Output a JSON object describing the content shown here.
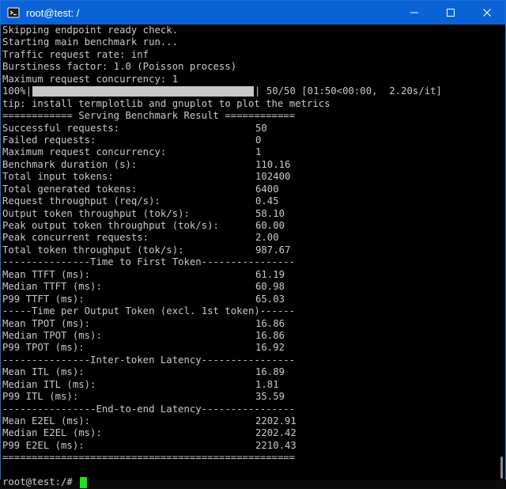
{
  "window": {
    "title": "root@test: /",
    "controls": [
      "minimize",
      "maximize",
      "close"
    ]
  },
  "terminal": {
    "intro_lines": [
      "Skipping endpoint ready check.",
      "Starting main benchmark run...",
      "Traffic request rate: inf",
      "Burstiness factor: 1.0 (Poisson process)",
      "Maximum request concurrency: 1"
    ],
    "progress": {
      "percent_label": "100%|",
      "fraction": 1.0,
      "status": "| 50/50 [01:50<00:00,  2.20s/it]"
    },
    "tip_line": "tip: install termplotlib and gnuplot to plot the metrics",
    "result_header": "============ Serving Benchmark Result ============",
    "summary": [
      {
        "label": "Successful requests:",
        "value": "50"
      },
      {
        "label": "Failed requests:",
        "value": "0"
      },
      {
        "label": "Maximum request concurrency:",
        "value": "1"
      },
      {
        "label": "Benchmark duration (s):",
        "value": "110.16"
      },
      {
        "label": "Total input tokens:",
        "value": "102400"
      },
      {
        "label": "Total generated tokens:",
        "value": "6400"
      },
      {
        "label": "Request throughput (req/s):",
        "value": "0.45"
      },
      {
        "label": "Output token throughput (tok/s):",
        "value": "58.10"
      },
      {
        "label": "Peak output token throughput (tok/s):",
        "value": "60.00"
      },
      {
        "label": "Peak concurrent requests:",
        "value": "2.00"
      },
      {
        "label": "Total token throughput (tok/s):",
        "value": "987.67"
      }
    ],
    "ttft_header": "---------------Time to First Token----------------",
    "ttft": [
      {
        "label": "Mean TTFT (ms):",
        "value": "61.19"
      },
      {
        "label": "Median TTFT (ms):",
        "value": "60.98"
      },
      {
        "label": "P99 TTFT (ms):",
        "value": "65.03"
      }
    ],
    "tpot_header": "-----Time per Output Token (excl. 1st token)------",
    "tpot": [
      {
        "label": "Mean TPOT (ms):",
        "value": "16.86"
      },
      {
        "label": "Median TPOT (ms):",
        "value": "16.86"
      },
      {
        "label": "P99 TPOT (ms):",
        "value": "16.92"
      }
    ],
    "itl_header": "---------------Inter-token Latency----------------",
    "itl": [
      {
        "label": "Mean ITL (ms):",
        "value": "16.89"
      },
      {
        "label": "Median ITL (ms):",
        "value": "1.81"
      },
      {
        "label": "P99 ITL (ms):",
        "value": "35.59"
      }
    ],
    "e2el_header": "----------------End-to-end Latency----------------",
    "e2el": [
      {
        "label": "Mean E2EL (ms):",
        "value": "2202.91"
      },
      {
        "label": "Median E2EL (ms):",
        "value": "2202.42"
      },
      {
        "label": "P99 E2EL (ms):",
        "value": "2210.43"
      }
    ],
    "footer_rule": "==================================================",
    "prompt": "root@test:/# "
  },
  "colors": {
    "titlebar": "#0a63d6",
    "terminal_bg": "#000000",
    "terminal_fg": "#c9c9c9",
    "cursor": "#19e619"
  }
}
